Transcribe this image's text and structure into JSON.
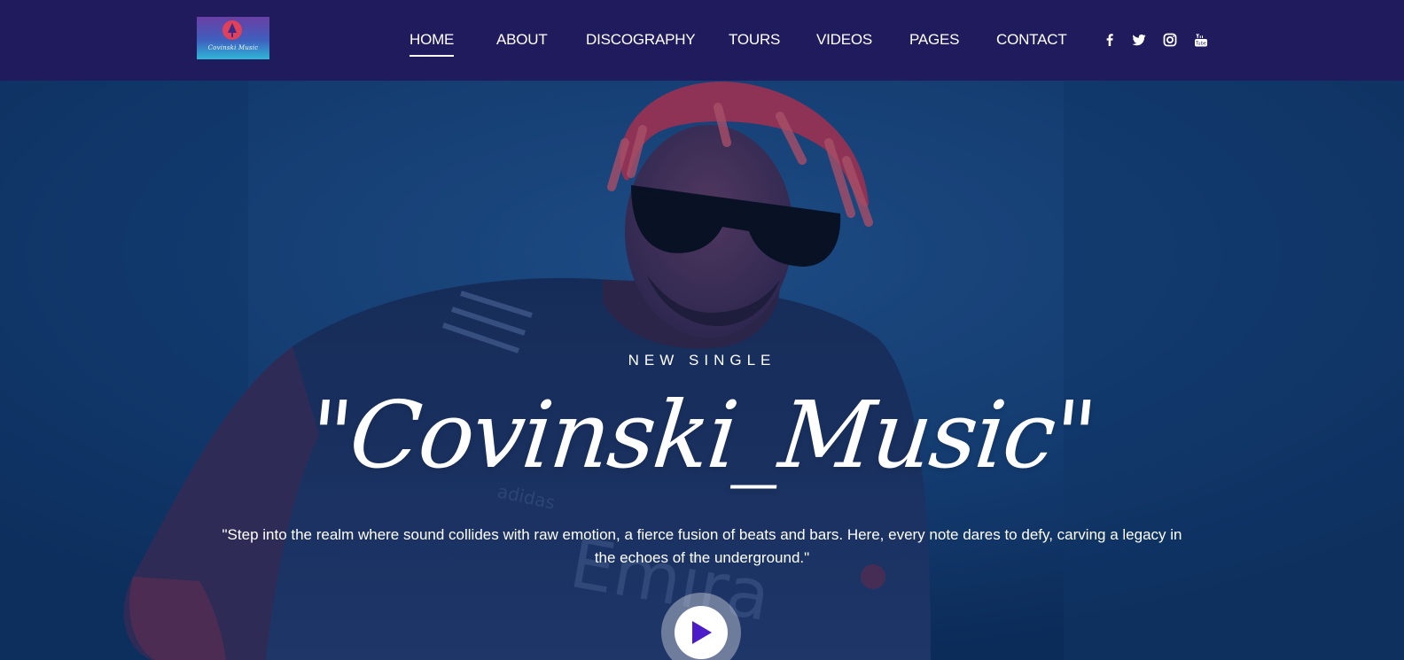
{
  "brand": {
    "logo_text": "Covinski Music"
  },
  "nav": {
    "items": [
      {
        "label": "HOME",
        "active": true
      },
      {
        "label": "ABOUT",
        "active": false
      },
      {
        "label": "DISCOGRAPHY",
        "active": false
      },
      {
        "label": "TOURS",
        "active": false
      },
      {
        "label": "VIDEOS",
        "active": false
      },
      {
        "label": "PAGES",
        "active": false
      },
      {
        "label": "CONTACT",
        "active": false
      }
    ],
    "social_icons": [
      "facebook-icon",
      "twitter-icon",
      "instagram-icon",
      "youtube-icon"
    ]
  },
  "hero": {
    "eyebrow": "NEW SINGLE",
    "title": "\"Covinski_Music\"",
    "description": "\"Step into the realm where sound collides with raw emotion, a fierce fusion of beats and bars. Here, every note dares to defy, carving a legacy in the echoes of the underground.\"",
    "play_icon": "play-icon"
  },
  "colors": {
    "header_bg": "#1f1b5c",
    "hero_bg": "#143f73",
    "play_accent": "#4b1cc8",
    "text": "#ffffff"
  }
}
